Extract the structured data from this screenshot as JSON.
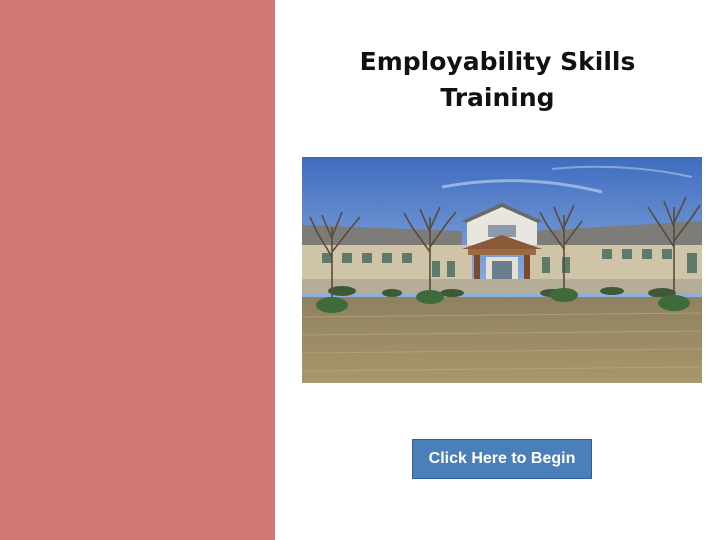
{
  "colors": {
    "sidebar": "#cf7876",
    "button_bg": "#4a7fba",
    "sky": "#4f79c4",
    "grass": "#9b8a63"
  },
  "slide": {
    "title_line1": "Employability Skills",
    "title_line2": "Training",
    "photo_icon": "building-photo",
    "button_label": "Click Here to Begin"
  }
}
